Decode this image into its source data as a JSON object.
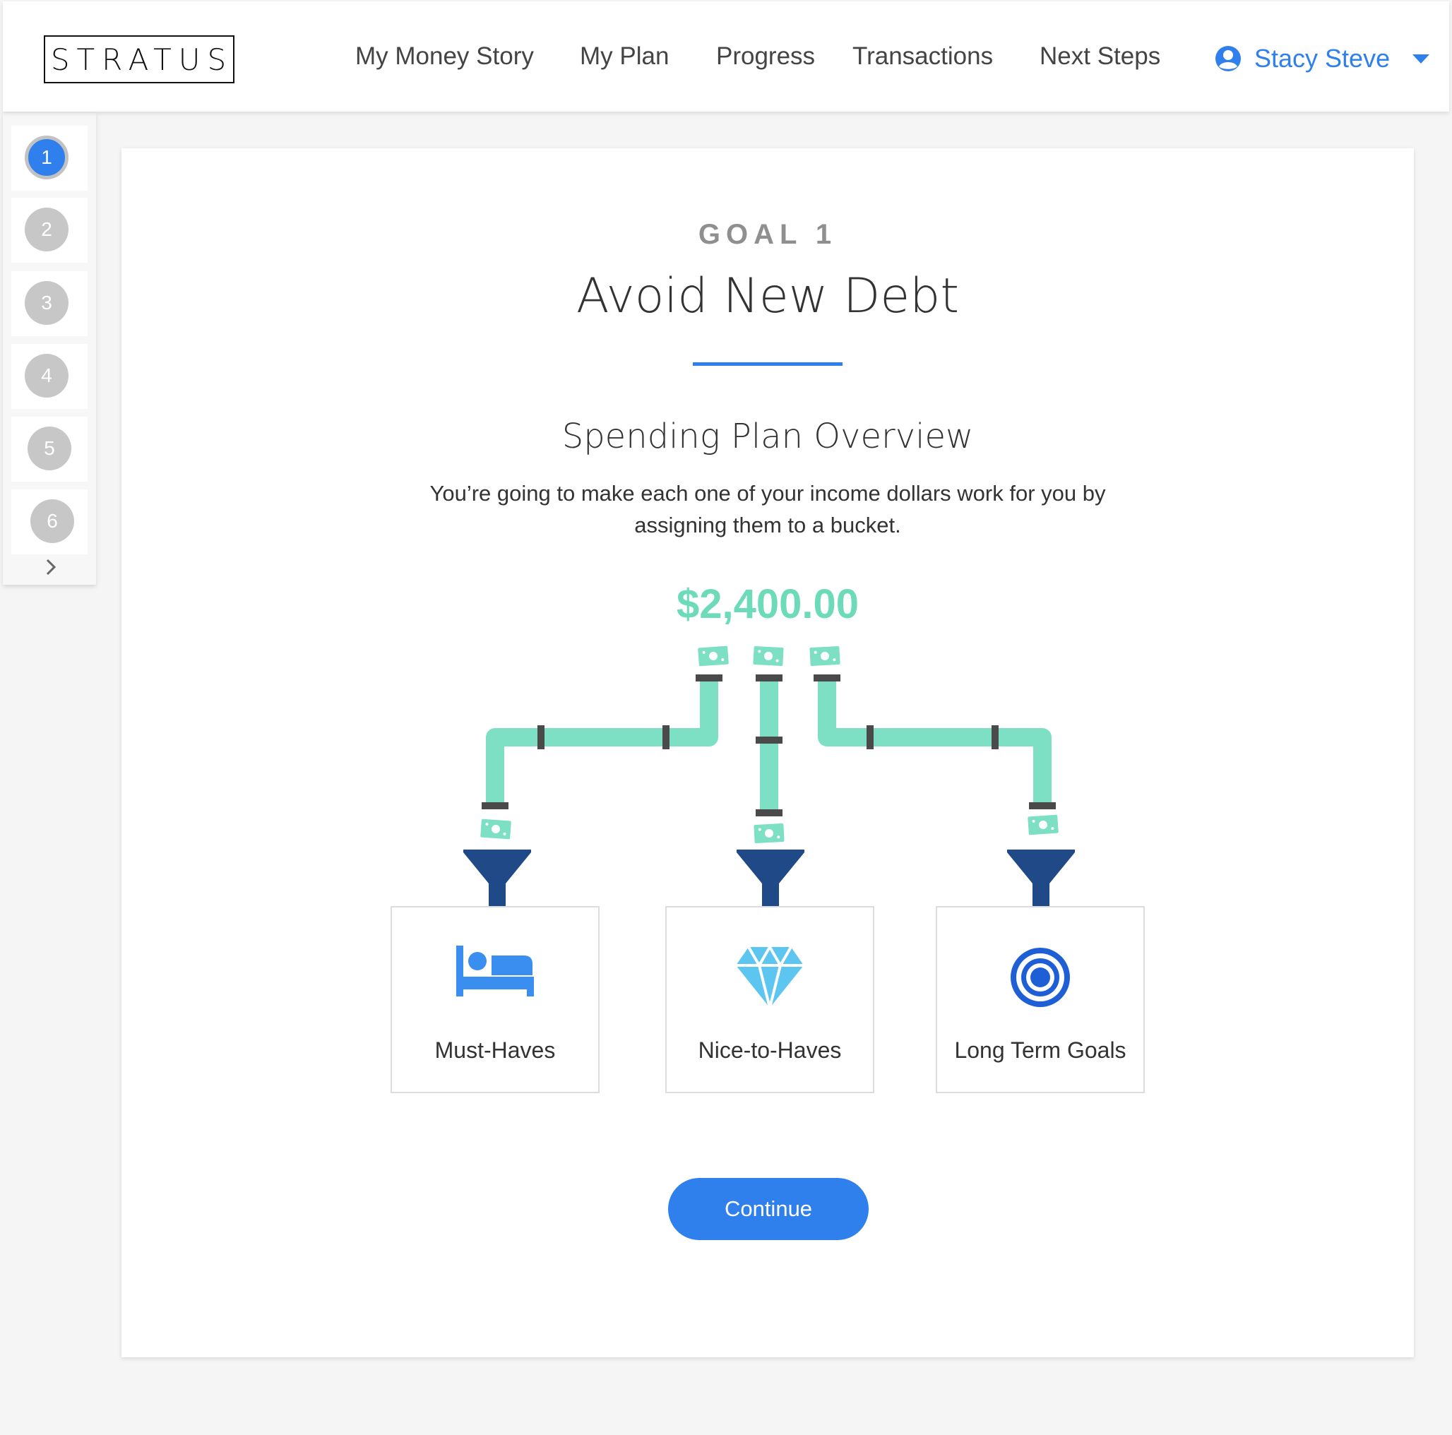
{
  "header": {
    "logo": "STRATUS",
    "nav": [
      "My Money Story",
      "My Plan",
      "Progress",
      "Transactions",
      "Next Steps"
    ],
    "user_name": "Stacy Steve"
  },
  "steps": {
    "items": [
      "1",
      "2",
      "3",
      "4",
      "5",
      "6"
    ],
    "active": 1
  },
  "goal": {
    "label": "GOAL 1",
    "title": "Avoid New Debt"
  },
  "overview": {
    "title": "Spending Plan Overview",
    "description": "You’re going to make each one of your income dollars work for you by assigning them to a bucket.",
    "amount": "$2,400.00"
  },
  "buckets": [
    {
      "label": "Must-Haves",
      "icon": "bed-icon"
    },
    {
      "label": "Nice-to-Haves",
      "icon": "diamond-icon"
    },
    {
      "label": "Long Term Goals",
      "icon": "target-icon"
    }
  ],
  "actions": {
    "continue_label": "Continue"
  },
  "colors": {
    "accent": "#2f80ed",
    "pipe": "#7ddfc3",
    "amount": "#6ddbb9",
    "funnel": "#1f4a87",
    "step_inactive": "#c7c7c7"
  }
}
